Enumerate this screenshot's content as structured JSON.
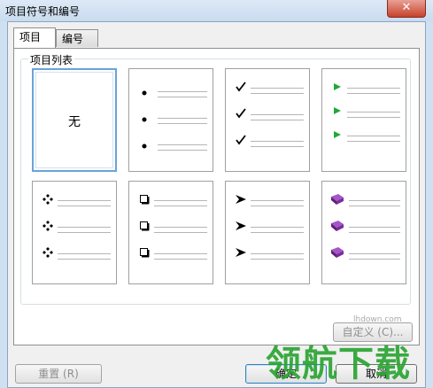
{
  "window": {
    "title": "项目符号和编号",
    "close_glyph": "✕"
  },
  "tabs": [
    {
      "label": "项目"
    },
    {
      "label": "编号"
    }
  ],
  "group": {
    "label": "项目列表"
  },
  "bullets": [
    {
      "id": "none",
      "text": "无",
      "selected": true
    },
    {
      "id": "dot",
      "icon": "dot-bullet-icon"
    },
    {
      "id": "check",
      "icon": "check-bullet-icon"
    },
    {
      "id": "triangle",
      "icon": "green-triangle-bullet-icon",
      "color": "#22a83a"
    },
    {
      "id": "diamond",
      "icon": "four-diamond-bullet-icon"
    },
    {
      "id": "square",
      "icon": "square-bullet-icon"
    },
    {
      "id": "arrow",
      "icon": "arrowhead-bullet-icon"
    },
    {
      "id": "book",
      "icon": "purple-book-bullet-icon",
      "color": "#7a2d9b"
    }
  ],
  "buttons": {
    "customize": "自定义 (C)...",
    "reset": "重置 (R)",
    "ok": "确定",
    "cancel": "取消"
  },
  "watermark": {
    "site": "lhdown.com",
    "brand": "领航下载"
  }
}
